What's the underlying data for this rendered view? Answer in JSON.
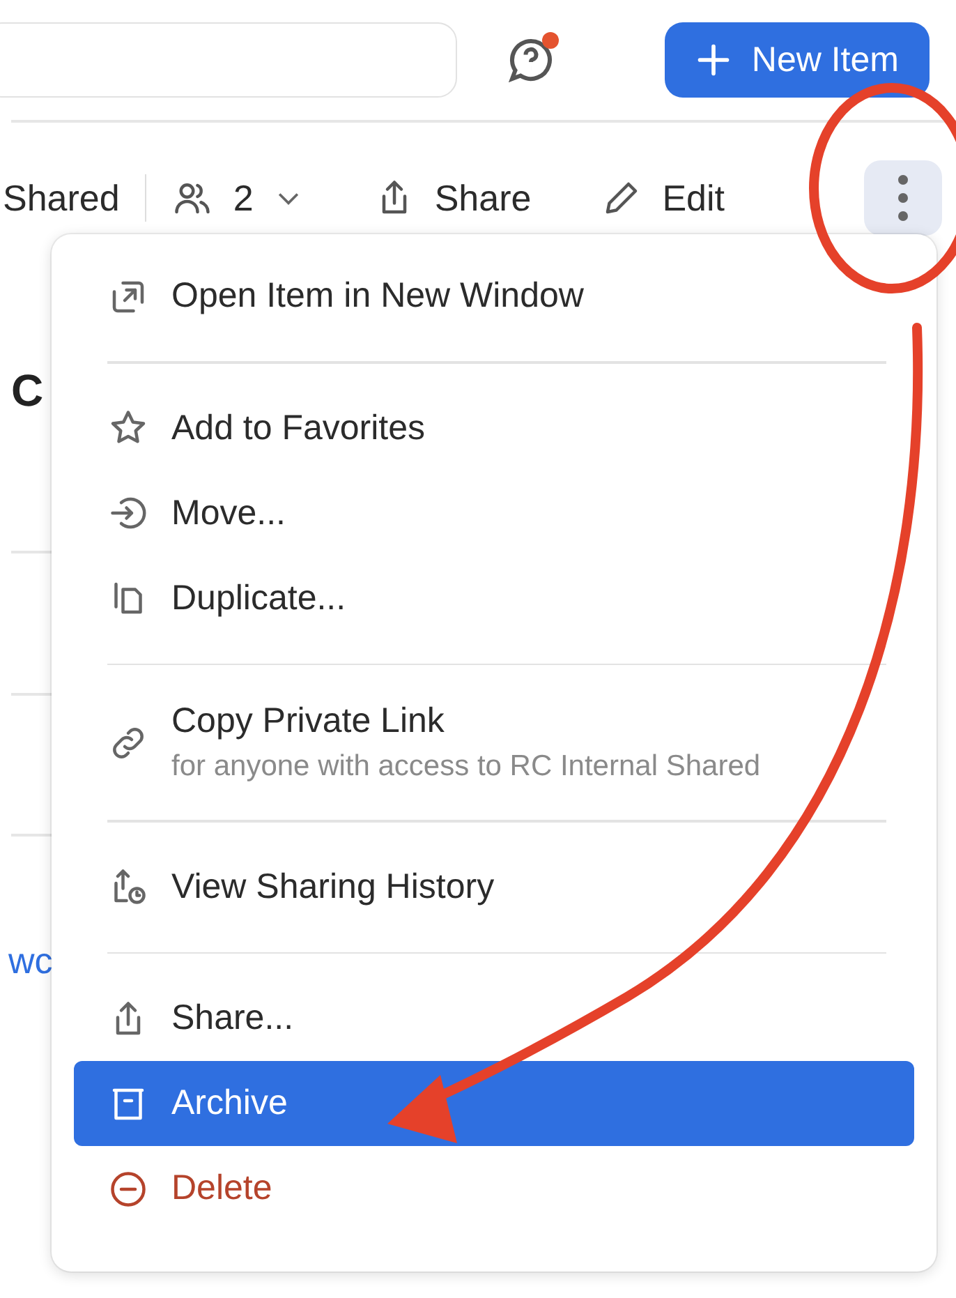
{
  "header": {
    "help": {
      "notification": true
    },
    "new_button": {
      "label": "New Item"
    }
  },
  "toolbar": {
    "location": "Shared",
    "members": "2",
    "share": "Share",
    "edit": "Edit",
    "more_selected": true
  },
  "background": {
    "heading": "C",
    "link": "wc"
  },
  "menu": {
    "groups": [
      [
        {
          "label": "Open Item in New Window",
          "kind": "normal",
          "selected": false
        }
      ],
      [
        {
          "label": "Add to Favorites",
          "kind": "normal",
          "selected": false
        },
        {
          "label": "Move...",
          "kind": "normal",
          "selected": false
        },
        {
          "label": "Duplicate...",
          "kind": "normal",
          "selected": false
        }
      ],
      [
        {
          "label": "Copy Private Link",
          "sublabel": "for anyone with access to RC Internal Shared",
          "kind": "normal",
          "selected": false
        }
      ],
      [
        {
          "label": "View Sharing History",
          "kind": "normal",
          "selected": false
        }
      ],
      [
        {
          "label": "Share...",
          "kind": "normal",
          "selected": false
        },
        {
          "label": "Archive",
          "kind": "normal",
          "selected": true
        },
        {
          "label": "Delete",
          "kind": "danger",
          "selected": false
        }
      ]
    ]
  }
}
